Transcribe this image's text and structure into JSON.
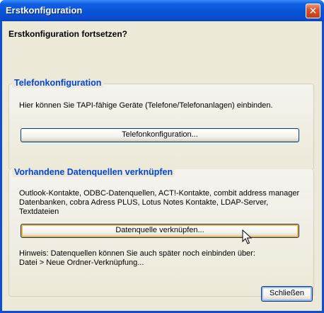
{
  "window": {
    "title": "Erstkonfiguration",
    "close_glyph": "✕"
  },
  "heading": "Erstkonfiguration fortsetzen?",
  "telefon": {
    "group_title": "Telefonkonfiguration",
    "description": "Hier können Sie TAPI-fähige Geräte (Telefone/Telefonanlagen) einbinden.",
    "button_label": "Telefonkonfiguration..."
  },
  "datenquellen": {
    "group_title": "Vorhandene Datenquellen verknüpfen",
    "description_lines": [
      "Outlook-Kontakte, ODBC-Datenquellen, ACT!-Kontakte, combit address manager",
      "Datenbanken, cobra Adress PLUS, Lotus Notes Kontakte, LDAP-Server,",
      "Textdateien"
    ],
    "button_label": "Datenquelle verknüpfen...",
    "hint_lines": [
      "Hinweis: Datenquellen können Sie auch später noch einbinden über:",
      "Datei > Neue Ordner-Verknüpfung..."
    ]
  },
  "footer": {
    "close_button_label": "Schließen"
  },
  "colors": {
    "titlebar": "#0a55d8",
    "group_title": "#0046d5",
    "dialog_bg": "#ece9d8",
    "focus_border": "#f8b33d"
  },
  "icons": {
    "close": "close-icon",
    "cursor": "mouse-pointer-icon"
  }
}
